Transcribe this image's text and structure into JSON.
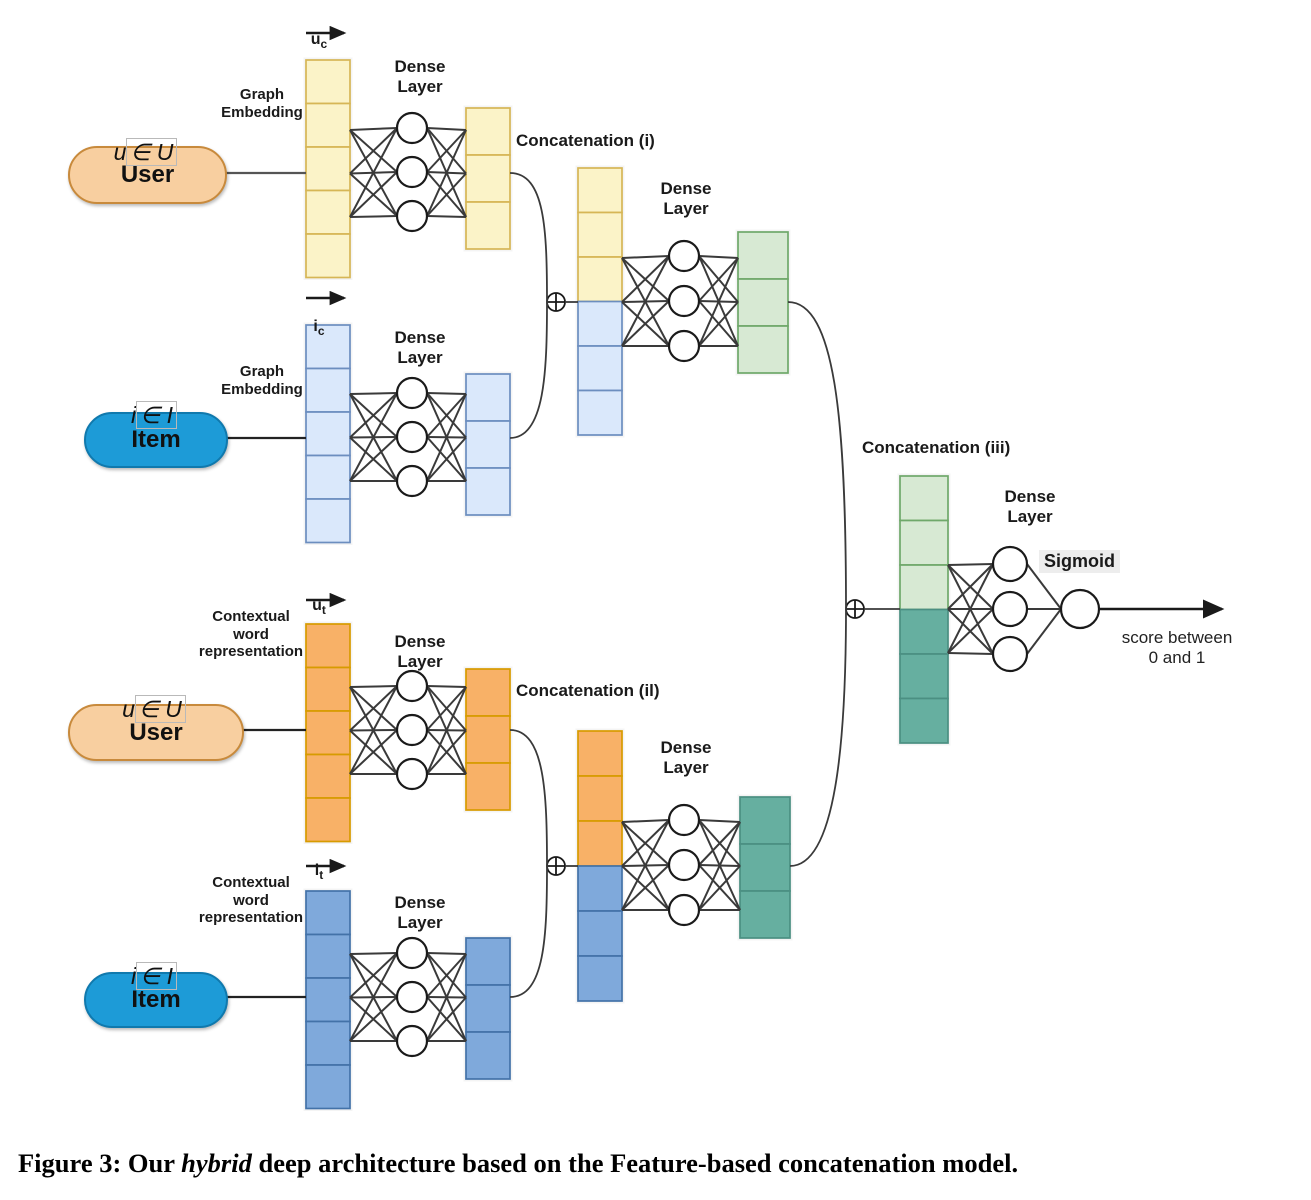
{
  "figure": {
    "caption_prefix": "Figure 3: Our ",
    "caption_italic": "hybrid",
    "caption_suffix": " deep architecture based on the Feature-based concatenation model."
  },
  "entities": {
    "user_top": {
      "label": "User",
      "set_var": "u",
      "set_member": "∈ U",
      "fill": "#F8CFA0",
      "stroke": "#C88A3C"
    },
    "item_top": {
      "label": "Item",
      "set_var": "i",
      "set_member": "∈ I",
      "fill": "#1D9BD7",
      "stroke": "#1079AD"
    },
    "user_bottom": {
      "label": "User",
      "set_var": "u",
      "set_member": "∈ U",
      "fill": "#F8CFA0",
      "stroke": "#C88A3C"
    },
    "item_bottom": {
      "label": "Item",
      "set_var": "i",
      "set_member": "∈ I",
      "fill": "#1D9BD7",
      "stroke": "#1079AD"
    }
  },
  "embedding_labels": {
    "graph_user": "Graph\nEmbedding",
    "graph_item": "Graph\nEmbedding",
    "context_user": "Contextual\nword\nrepresentation",
    "context_item": "Contextual\nword\nrepresentation"
  },
  "vector_labels": {
    "u_c": {
      "base": "u",
      "sub": "c"
    },
    "i_c": {
      "base": "i",
      "sub": "c"
    },
    "u_t": {
      "base": "u",
      "sub": "t"
    },
    "i_t": {
      "base": "i",
      "sub": "t"
    }
  },
  "dense_layer_label": "Dense\nLayer",
  "dense_layers": [
    {
      "name": "dense-user-graph",
      "label": "Dense\nLayer"
    },
    {
      "name": "dense-item-graph",
      "label": "Dense\nLayer"
    },
    {
      "name": "dense-concat-i",
      "label": "Dense\nLayer"
    },
    {
      "name": "dense-user-context",
      "label": "Dense\nLayer"
    },
    {
      "name": "dense-item-context",
      "label": "Dense\nLayer"
    },
    {
      "name": "dense-concat-ii",
      "label": "Dense\nLayer"
    },
    {
      "name": "dense-concat-iii",
      "label": "Dense\nLayer"
    }
  ],
  "concatenations": {
    "i": {
      "label": "Concatenation (i)",
      "top_fill": "#FBF3C8",
      "bottom_fill": "#DAE8FB"
    },
    "ii": {
      "label": "Concatenation (il)",
      "top_fill": "#F8B167",
      "bottom_fill": "#7FA9DB"
    },
    "iii": {
      "label": "Concatenation (iii)",
      "top_fill": "#D7E9D3",
      "bottom_fill": "#66AFA0"
    }
  },
  "output": {
    "activation": "Sigmoid",
    "score_text": "score between\n0 and 1"
  },
  "colors": {
    "yellow_fill": "#FBF3C8",
    "yellow_stroke": "#D6B656",
    "light_blue_fill": "#DAE8FB",
    "light_blue_stroke": "#6C8EBF",
    "orange_fill": "#F8B167",
    "orange_stroke": "#D79B00",
    "mid_blue_fill": "#7FA9DB",
    "mid_blue_stroke": "#4372A8",
    "light_green_fill": "#D7E9D3",
    "light_green_stroke": "#6FA86A",
    "teal_fill": "#66AFA0",
    "teal_stroke": "#4B8F82",
    "line": "#3a3a3a",
    "node_stroke": "#1a1a1a"
  },
  "vectors": {
    "u_c_in": {
      "cells": 5,
      "fill": "#FBF3C8",
      "stroke": "#D6B656"
    },
    "u_c_out": {
      "cells": 3,
      "fill": "#FBF3C8",
      "stroke": "#D6B656"
    },
    "i_c_in": {
      "cells": 5,
      "fill": "#DAE8FB",
      "stroke": "#6C8EBF"
    },
    "i_c_out": {
      "cells": 3,
      "fill": "#DAE8FB",
      "stroke": "#6C8EBF"
    },
    "u_t_in": {
      "cells": 5,
      "fill": "#F8B167",
      "stroke": "#D79B00"
    },
    "u_t_out": {
      "cells": 3,
      "fill": "#F8B167",
      "stroke": "#D79B00"
    },
    "i_t_in": {
      "cells": 5,
      "fill": "#7FA9DB",
      "stroke": "#4372A8"
    },
    "i_t_out": {
      "cells": 3,
      "fill": "#7FA9DB",
      "stroke": "#4372A8"
    },
    "concat_i_out": {
      "cells": 3,
      "fill": "#D7E9D3",
      "stroke": "#6FA86A"
    },
    "concat_ii_out": {
      "cells": 3,
      "fill": "#66AFA0",
      "stroke": "#4B8F82"
    }
  }
}
